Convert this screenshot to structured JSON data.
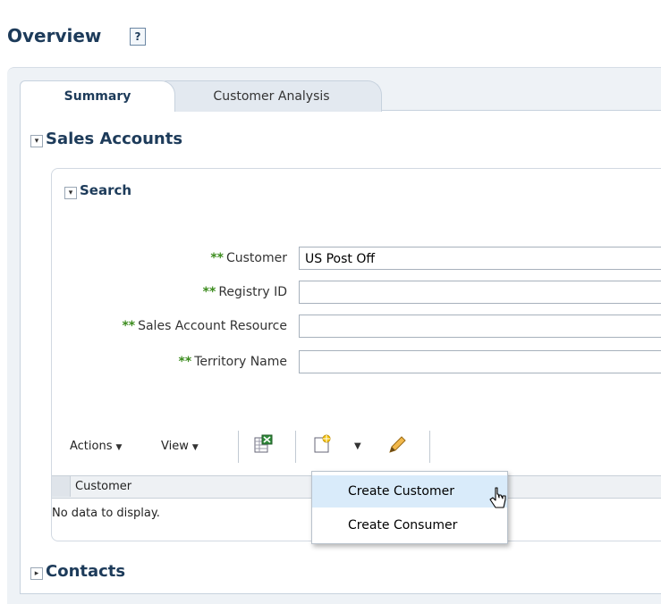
{
  "page": {
    "title": "Overview",
    "help_glyph": "?"
  },
  "tabs": [
    {
      "label": "Summary",
      "selected": true
    },
    {
      "label": "Customer Analysis",
      "selected": false
    }
  ],
  "sales_accounts": {
    "title": "Sales Accounts",
    "expanded": true,
    "search": {
      "title": "Search",
      "expanded": true,
      "required_marker": "**",
      "fields": [
        {
          "label": "Customer",
          "value": "US Post Off"
        },
        {
          "label": "Registry ID",
          "value": ""
        },
        {
          "label": "Sales Account Resource",
          "value": ""
        },
        {
          "label": "Territory Name",
          "value": ""
        }
      ]
    },
    "toolbar": {
      "actions_label": "Actions",
      "view_label": "View",
      "icons": [
        "export-to-excel-icon",
        "create-icon",
        "edit-pencil-icon"
      ]
    },
    "table": {
      "columns": [
        "Customer"
      ],
      "empty_text": "No data to display."
    },
    "create_menu": {
      "items": [
        {
          "label": "Create Customer",
          "highlighted": true
        },
        {
          "label": "Create Consumer",
          "highlighted": false
        }
      ]
    }
  },
  "contacts": {
    "title": "Contacts",
    "expanded": false
  },
  "colors": {
    "title_blue": "#1d3b5a",
    "required_green": "#3c8c1e",
    "menu_highlight": "#d9ebfa"
  }
}
